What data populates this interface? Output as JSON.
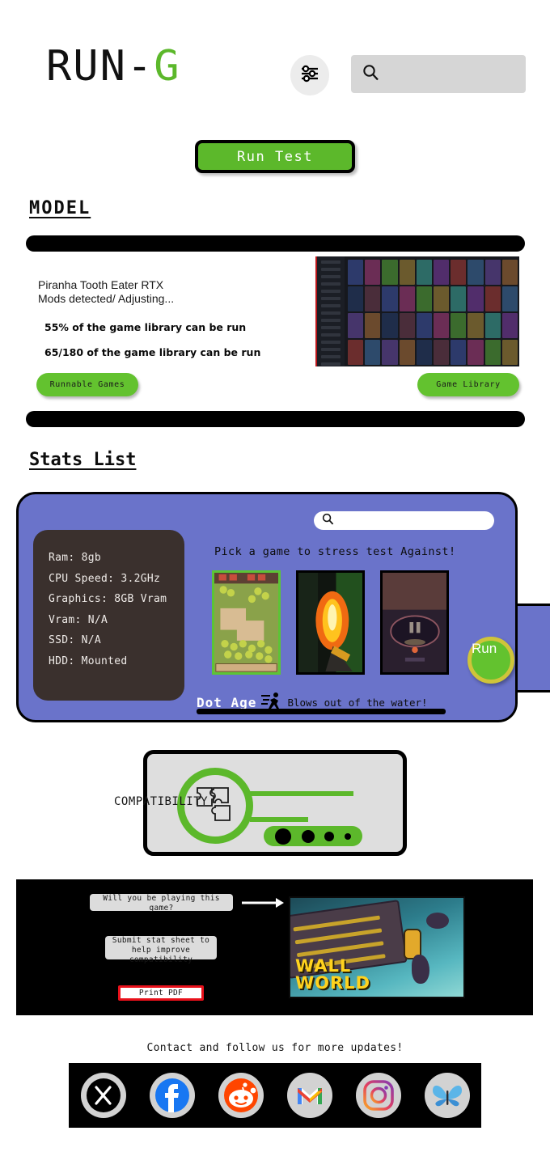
{
  "header": {
    "logo_main": "RUN-",
    "logo_accent": "G",
    "filter_icon": "sliders-icon",
    "search_icon": "search-icon",
    "search_value": "",
    "search_placeholder": ""
  },
  "actions": {
    "run_test": "Run Test"
  },
  "model": {
    "heading": "MODEL",
    "title": "Piranha Tooth Eater RTX",
    "subtitle": "Mods detected/ Adjusting...",
    "stat_percent": "55% of the game library can be run",
    "stat_ratio": "65/180 of the game library can be run",
    "btn_runnable": "Runnable Games",
    "btn_library": "Game Library",
    "screenshot_alt": "game-library-screenshot"
  },
  "stats": {
    "heading": "Stats List",
    "specs": [
      "Ram: 8gb",
      "CPU Speed: 3.2GHz",
      "Graphics: 8GB Vram",
      "Vram: N/A",
      "SSD: N/A",
      "HDD: Mounted"
    ],
    "search_value": "",
    "search_placeholder": "",
    "pick_label": "Pick a game to stress test Against!",
    "thumbnails": [
      {
        "name": "farm-pixel-game-thumbnail",
        "style": "green"
      },
      {
        "name": "fire-fps-game-thumbnail",
        "style": "dark"
      },
      {
        "name": "cave-cockpit-game-thumbnail",
        "style": "dark"
      }
    ],
    "result_game": "Dot Age",
    "result_icon": "runner-icon",
    "result_text": "Blows out of the water!",
    "run_button": "Run"
  },
  "compatibility": {
    "label": "COMPATIBILITY",
    "icon": "puzzle-icon",
    "dot_count": 4,
    "dot_sizes": [
      20,
      16,
      12,
      8
    ]
  },
  "promo": {
    "btn_playing": "Will you be playing this game?",
    "btn_submit": "Submit stat sheet to help improve compatibility",
    "btn_print": "Print PDF",
    "arrow_icon": "arrow-right-icon",
    "game_title_line1": "WALL",
    "game_title_line2": "WORLD"
  },
  "footer": {
    "contact_text": "Contact and follow us for more updates!",
    "socials": [
      {
        "name": "x-twitter-icon",
        "label": "X"
      },
      {
        "name": "facebook-icon",
        "label": "f"
      },
      {
        "name": "reddit-icon",
        "label": "reddit"
      },
      {
        "name": "gmail-icon",
        "label": "M"
      },
      {
        "name": "instagram-icon",
        "label": "instagram"
      },
      {
        "name": "bluesky-butterfly-icon",
        "label": "butterfly"
      }
    ]
  },
  "colors": {
    "accent_green": "#5cb82b",
    "button_green": "#63c22f",
    "panel_purple": "#6a73ca",
    "spec_card": "#3a302d",
    "print_red": "#e8111b",
    "run_ring": "#cfc43a"
  }
}
